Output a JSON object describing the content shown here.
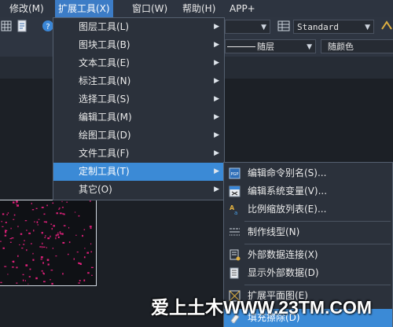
{
  "menubar": {
    "items": [
      {
        "label": "修改(M)"
      },
      {
        "label": "扩展工具(X)"
      },
      {
        "label": "窗口(W)"
      },
      {
        "label": "帮助(H)"
      },
      {
        "label": "APP+"
      }
    ]
  },
  "toolbar": {
    "text_style_value": "Standard",
    "layer_linetype_value": "随层",
    "layer_color_value": "随颜色"
  },
  "dropdown": {
    "items": [
      {
        "label": "图层工具(L)"
      },
      {
        "label": "图块工具(B)"
      },
      {
        "label": "文本工具(E)"
      },
      {
        "label": "标注工具(N)"
      },
      {
        "label": "选择工具(S)"
      },
      {
        "label": "编辑工具(M)"
      },
      {
        "label": "绘图工具(D)"
      },
      {
        "label": "文件工具(F)"
      },
      {
        "label": "定制工具(T)"
      },
      {
        "label": "其它(O)"
      }
    ],
    "highlighted": "定制工具(T)"
  },
  "submenu": {
    "items": [
      {
        "label": "编辑命令别名(S)...",
        "icon": "pgp-file-icon"
      },
      {
        "label": "编辑系统变量(V)...",
        "icon": "system-variable-icon"
      },
      {
        "label": "比例缩放列表(E)...",
        "icon": "scale-list-icon"
      },
      {
        "label": "制作线型(N)",
        "icon": "linetype-icon"
      },
      {
        "label": "外部数据连接(X)",
        "icon": "data-link-icon"
      },
      {
        "label": "显示外部数据(D)",
        "icon": "external-data-icon"
      },
      {
        "label": "扩展平面图(E)",
        "icon": "floorplan-icon"
      },
      {
        "label": "填充擦除(D)",
        "icon": "eraser-icon"
      }
    ],
    "highlighted": "填充擦除(D)"
  },
  "watermark": "爱上土木WWW.23TM.COM",
  "colors": {
    "accent": "#3b8ad6",
    "menubar_active": "#3c7cc6",
    "hatch": "#e0207a"
  }
}
